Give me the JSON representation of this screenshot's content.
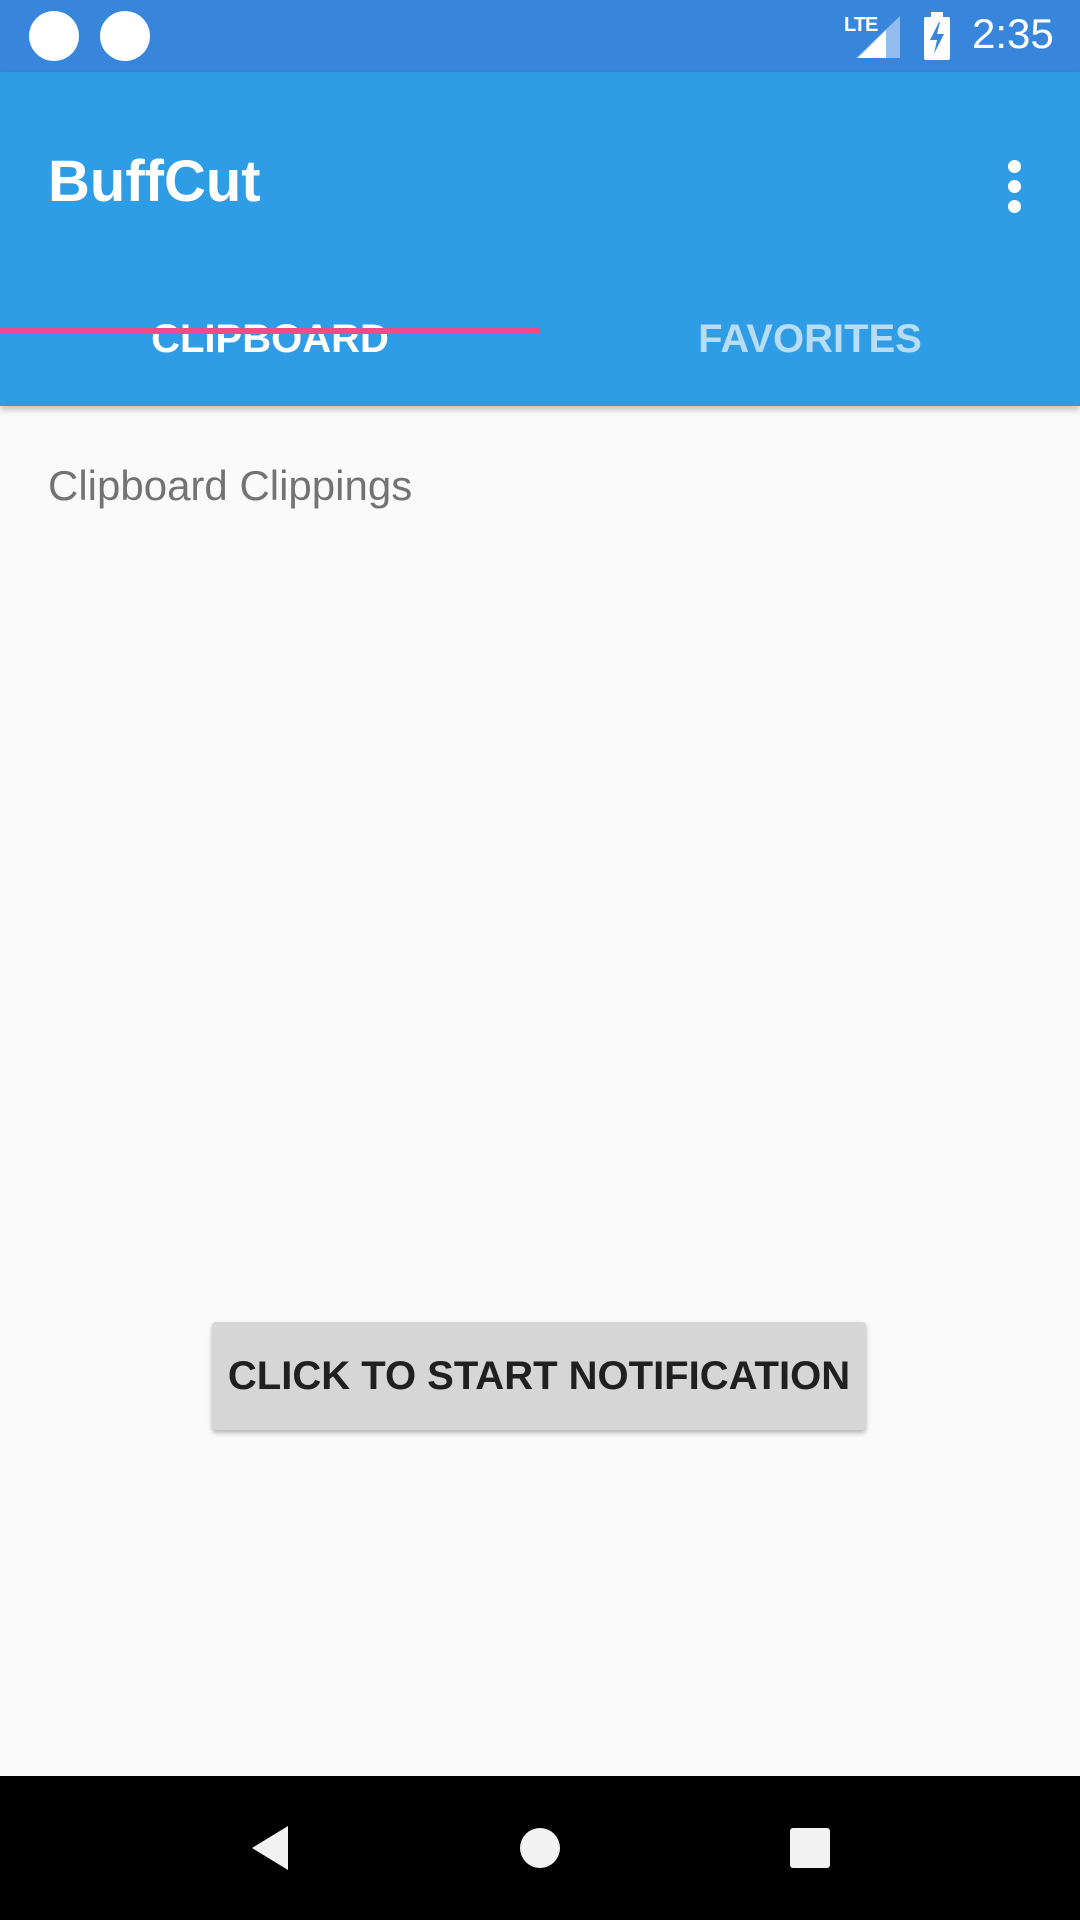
{
  "status_bar": {
    "network_label": "LTE",
    "time": "2:35",
    "icons": [
      "notification-dot-icon",
      "notification-dot-icon",
      "lte-signal-icon",
      "battery-charging-icon"
    ]
  },
  "app_bar": {
    "title": "BuffCut",
    "overflow_icon": "more-vert-icon"
  },
  "tabs": [
    {
      "label": "CLIPBOARD",
      "selected": true
    },
    {
      "label": "FAVORITES",
      "selected": false
    }
  ],
  "content": {
    "section_title": "Clipboard Clippings",
    "start_button_label": "CLICK TO START NOTIFICATION"
  },
  "nav_bar": {
    "icons": [
      "back-icon",
      "home-icon",
      "recents-icon"
    ]
  },
  "colors": {
    "status_bar": "#3886dc",
    "app_bar": "#2f9de6",
    "tab_indicator": "#f2488c",
    "background": "#fafafa",
    "button": "#d6d6d6"
  }
}
